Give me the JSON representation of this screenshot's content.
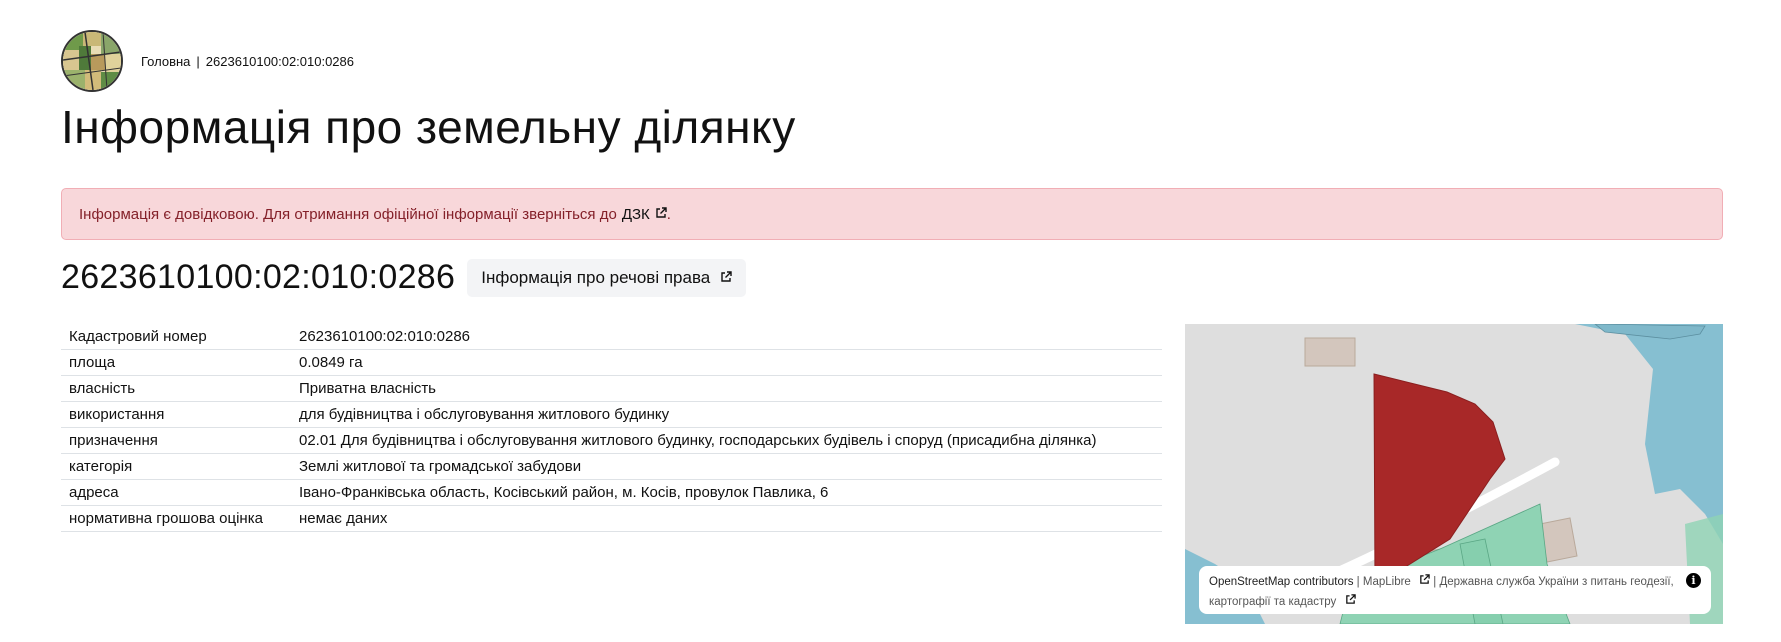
{
  "breadcrumb": {
    "home": "Головна",
    "separator": "|",
    "current": "2623610100:02:010:0286"
  },
  "page_title": "Інформація про земельну ділянку",
  "alert": {
    "text": "Інформація є довідковою. Для отримання офіційної інформації зверніться до",
    "link": "ДЗК",
    "suffix": ".",
    "colors": {
      "background": "#f8d7da",
      "border": "#f1aeb5",
      "text": "#842029"
    }
  },
  "parcel": {
    "number": "2623610100:02:010:0286",
    "rights_button": "Інформація про речові права"
  },
  "table": {
    "rows": [
      {
        "key": "Кадастровий номер",
        "value": "2623610100:02:010:0286"
      },
      {
        "key": "площа",
        "value": "0.0849 га"
      },
      {
        "key": "власність",
        "value": "Приватна власність"
      },
      {
        "key": "використання",
        "value": "для будівництва і обслуговування житлового будинку"
      },
      {
        "key": "призначення",
        "value": "02.01 Для будівництва і обслуговування житлового будинку, господарських будівель і споруд (присадибна ділянка)"
      },
      {
        "key": "категорія",
        "value": "Землі житлової та громадської забудови"
      },
      {
        "key": "адреса",
        "value": "Івано-Франківська область, Косівський район, м. Косів, провулок Павлика, 6"
      },
      {
        "key": "нормативна грошова оцінка",
        "value": "немає даних"
      }
    ]
  },
  "map": {
    "parcel_color": "#a82828",
    "water_color": "#86bfd1",
    "green_color": "#8fd3b4",
    "attribution": {
      "osm": "OpenStreetMap contributors",
      "sep1": "|",
      "maplibre": "MapLibre",
      "sep2": "|",
      "dzk": "Державна служба України з питань геодезії, картографії та кадастру"
    },
    "info_icon": "i"
  }
}
